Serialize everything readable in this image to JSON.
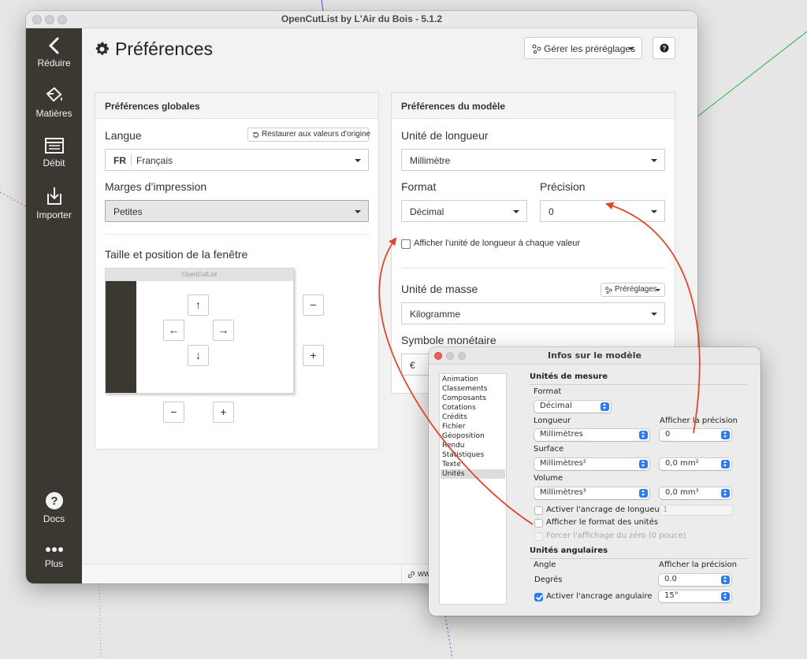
{
  "app": {
    "window_title": "OpenCutList by L'Air du Bois - 5.1.2",
    "sidebar": [
      {
        "label": "Réduire",
        "icon": "chevron-left-icon"
      },
      {
        "label": "Matières",
        "icon": "paint-bucket-icon"
      },
      {
        "label": "Débit",
        "icon": "cutlist-icon"
      },
      {
        "label": "Importer",
        "icon": "import-icon"
      },
      {
        "label": "Docs",
        "icon": "help-circle-icon"
      },
      {
        "label": "Plus",
        "icon": "more-dots-icon"
      }
    ],
    "page_title": "Préférences",
    "manage_presets_label": "Gérer les préréglages",
    "help_label": "?",
    "status_link": "ww"
  },
  "global": {
    "header": "Préférences globales",
    "language_label": "Langue",
    "restore_label": "Restaurer aux valeurs d'origine",
    "language_code": "FR",
    "language_value": "Français",
    "print_margins_label": "Marges d’impression",
    "print_margins_value": "Petites",
    "window_size_label": "Taille et position de la fenêtre",
    "preview_title": "OpenCutList",
    "arrows": {
      "up": "↑",
      "left": "←",
      "right": "→",
      "down": "↓",
      "minus": "−",
      "plus": "+"
    }
  },
  "model": {
    "header": "Préférences du modèle",
    "length_unit_label": "Unité de longueur",
    "length_unit_value": "Millimètre",
    "format_label": "Format",
    "format_value": "Décimal",
    "precision_label": "Précision",
    "precision_value": "0",
    "show_unit_label": "Afficher l'unité de longueur à chaque valeur",
    "mass_unit_label": "Unité de masse",
    "mass_presets_label": "Préréglages",
    "mass_unit_value": "Kilogramme",
    "currency_label": "Symbole monétaire",
    "currency_value": "€"
  },
  "dialog": {
    "title": "Infos sur le modèle",
    "list": [
      "Animation",
      "Classements",
      "Composants",
      "Cotations",
      "Crédits",
      "Fichier",
      "Géoposition",
      "Rendu",
      "Statistiques",
      "Texte",
      "Unités"
    ],
    "selected": "Unités",
    "units_header": "Unités de mesure",
    "format_label": "Format",
    "format_value": "Décimal",
    "length_label": "Longueur",
    "length_value": "Millimètres",
    "show_precision_label": "Afficher la précision",
    "length_precision": "0",
    "area_label": "Surface",
    "area_value": "Millimètres²",
    "area_precision": "0,0 mm²",
    "volume_label": "Volume",
    "volume_value": "Millimètres³",
    "volume_precision": "0,0 mm³",
    "snap_length_label": "Activer l'ancrage de longueur",
    "snap_length_value": "1",
    "show_format_label": "Afficher le format des unités",
    "force_zero_label": "Forcer l'affichage du zéro (0 pouce)",
    "angular_header": "Unités angulaires",
    "angle_label": "Angle",
    "angle_precision_label": "Afficher la précision",
    "degrees_label": "Degrés",
    "angle_precision": "0.0",
    "snap_angle_label": "Activer l'ancrage angulaire",
    "snap_angle_value": "15°"
  },
  "colors": {
    "sidebar": "#3b3731",
    "accent": "#2d7cf6",
    "annotation": "#e0462c"
  }
}
